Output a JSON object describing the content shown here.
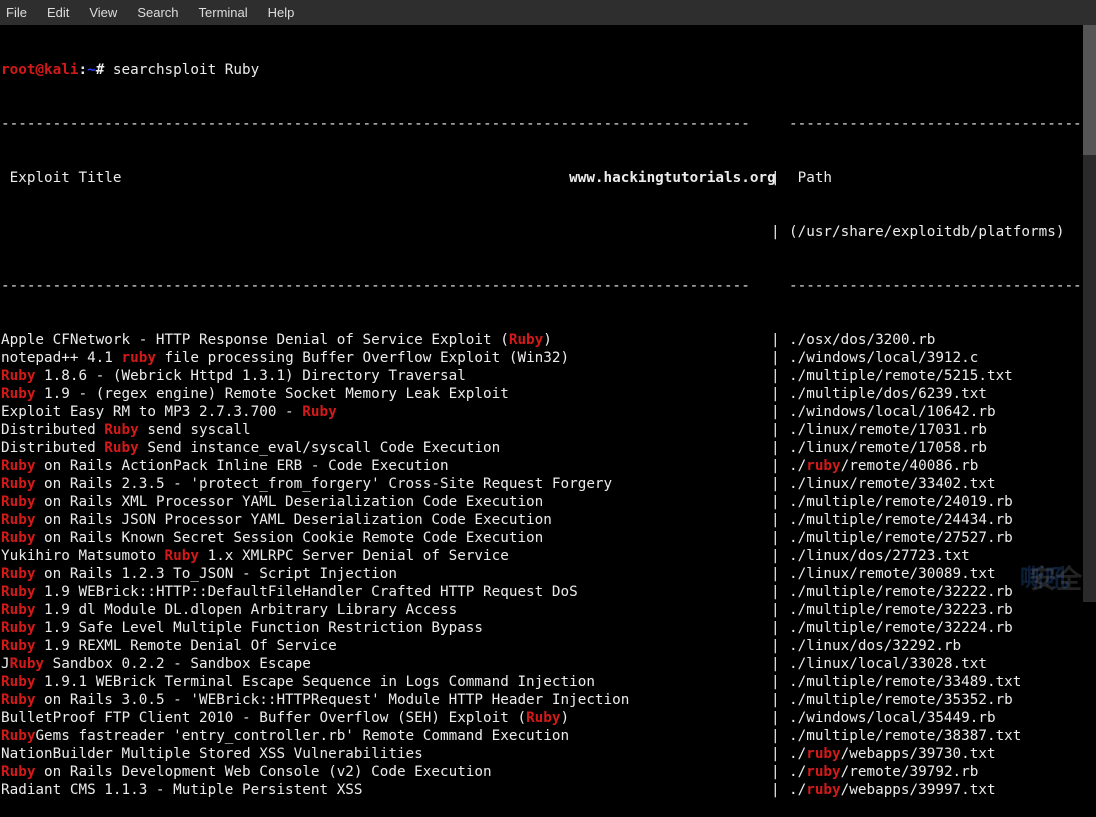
{
  "menu": {
    "file": "File",
    "edit": "Edit",
    "view": "View",
    "search": "Search",
    "terminal": "Terminal",
    "help": "Help"
  },
  "prompt": {
    "user": "root@kali",
    "colon": ":",
    "path": "~",
    "hash": "#",
    "command": "searchsploit Ruby"
  },
  "site": "www.hackingtutorials.org",
  "header": {
    "title_label": " Exploit Title",
    "path_label": " Path",
    "path_sub": "(/usr/share/exploitdb/platforms)"
  },
  "rows": [
    {
      "pre": "Apple CFNetwork - HTTP Response Denial of Service Exploit (",
      "hi": "Ruby",
      "post": ")",
      "path": "./osx/dos/3200.rb"
    },
    {
      "pre": "notepad++ 4.1 ",
      "hi": "ruby",
      "post": " file processing Buffer Overflow Exploit (Win32)",
      "path": "./windows/local/3912.c"
    },
    {
      "pre": "",
      "hi": "Ruby",
      "post": " 1.8.6 - (Webrick Httpd 1.3.1) Directory Traversal",
      "path": "./multiple/remote/5215.txt"
    },
    {
      "pre": "",
      "hi": "Ruby",
      "post": " 1.9 - (regex engine) Remote Socket Memory Leak Exploit",
      "path": "./multiple/dos/6239.txt"
    },
    {
      "pre": "Exploit Easy RM to MP3 2.7.3.700 - ",
      "hi": "Ruby",
      "post": "",
      "path": "./windows/local/10642.rb"
    },
    {
      "pre": "Distributed ",
      "hi": "Ruby",
      "post": " send syscall",
      "path": "./linux/remote/17031.rb"
    },
    {
      "pre": "Distributed ",
      "hi": "Ruby",
      "post": " Send instance_eval/syscall Code Execution",
      "path": "./linux/remote/17058.rb"
    },
    {
      "pre": "",
      "hi": "Ruby",
      "post": " on Rails ActionPack Inline ERB - Code Execution",
      "path_pre": "./",
      "path_hi": "ruby",
      "path_post": "/remote/40086.rb"
    },
    {
      "pre": "",
      "hi": "Ruby",
      "post": " on Rails 2.3.5 - 'protect_from_forgery' Cross-Site Request Forgery",
      "path": "./linux/remote/33402.txt"
    },
    {
      "pre": "",
      "hi": "Ruby",
      "post": " on Rails XML Processor YAML Deserialization Code Execution",
      "path": "./multiple/remote/24019.rb"
    },
    {
      "pre": "",
      "hi": "Ruby",
      "post": " on Rails JSON Processor YAML Deserialization Code Execution",
      "path": "./multiple/remote/24434.rb"
    },
    {
      "pre": "",
      "hi": "Ruby",
      "post": " on Rails Known Secret Session Cookie Remote Code Execution",
      "path": "./multiple/remote/27527.rb"
    },
    {
      "pre": "Yukihiro Matsumoto ",
      "hi": "Ruby",
      "post": " 1.x XMLRPC Server Denial of Service",
      "path": "./linux/dos/27723.txt"
    },
    {
      "pre": "",
      "hi": "Ruby",
      "post": " on Rails 1.2.3 To_JSON - Script Injection",
      "path": "./linux/remote/30089.txt"
    },
    {
      "pre": "",
      "hi": "Ruby",
      "post": " 1.9 WEBrick::HTTP::DefaultFileHandler Crafted HTTP Request DoS",
      "path": "./multiple/remote/32222.rb"
    },
    {
      "pre": "",
      "hi": "Ruby",
      "post": " 1.9 dl Module DL.dlopen Arbitrary Library Access",
      "path": "./multiple/remote/32223.rb"
    },
    {
      "pre": "",
      "hi": "Ruby",
      "post": " 1.9 Safe Level Multiple Function Restriction Bypass",
      "path": "./multiple/remote/32224.rb"
    },
    {
      "pre": "",
      "hi": "Ruby",
      "post": " 1.9 REXML Remote Denial Of Service",
      "path": "./linux/dos/32292.rb"
    },
    {
      "pre": "J",
      "hi": "Ruby",
      "post": " Sandbox 0.2.2 - Sandbox Escape",
      "path": "./linux/local/33028.txt"
    },
    {
      "pre": "",
      "hi": "Ruby",
      "post": " 1.9.1 WEBrick Terminal Escape Sequence in Logs Command Injection",
      "path": "./multiple/remote/33489.txt"
    },
    {
      "pre": "",
      "hi": "Ruby",
      "post": " on Rails 3.0.5 - 'WEBrick::HTTPRequest' Module HTTP Header Injection",
      "path": "./multiple/remote/35352.rb"
    },
    {
      "pre": "BulletProof FTP Client 2010 - Buffer Overflow (SEH) Exploit (",
      "hi": "Ruby",
      "post": ")",
      "path": "./windows/local/35449.rb"
    },
    {
      "pre": "",
      "hi": "Ruby",
      "post": "Gems fastreader 'entry_controller.rb' Remote Command Execution",
      "path": "./multiple/remote/38387.txt"
    },
    {
      "pre": "NationBuilder Multiple Stored XSS Vulnerabilities",
      "hi": "",
      "post": "",
      "path_pre": "./",
      "path_hi": "ruby",
      "path_post": "/webapps/39730.txt"
    },
    {
      "pre": "",
      "hi": "Ruby",
      "post": " on Rails Development Web Console (v2) Code Execution",
      "path_pre": "./",
      "path_hi": "ruby",
      "path_post": "/remote/39792.rb"
    },
    {
      "pre": "Radiant CMS 1.1.3 - Mutiple Persistent XSS",
      "hi": "",
      "post": "",
      "path_pre": "./",
      "path_hi": "ruby",
      "path_post": "/webapps/39997.txt"
    }
  ],
  "watermark": {
    "a": "嘶吼",
    "b": "安全"
  }
}
